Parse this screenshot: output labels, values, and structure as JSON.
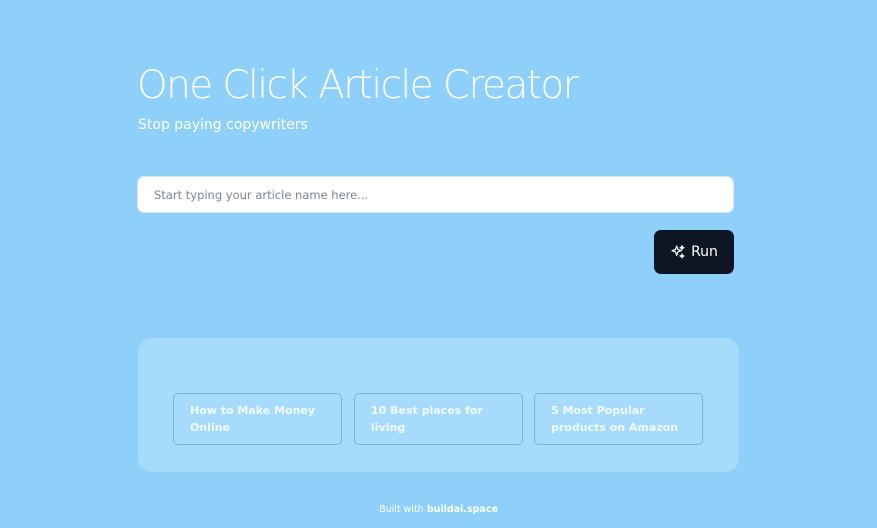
{
  "header": {
    "title": "One Click Article Creator",
    "subtitle": "Stop paying copywriters"
  },
  "search": {
    "placeholder": "Start typing your article name here...",
    "value": ""
  },
  "run_button": {
    "label": "Run",
    "icon": "sparkles-icon"
  },
  "suggestions": [
    {
      "label": "How to Make Money Online"
    },
    {
      "label": "10 Best places for living"
    },
    {
      "label": "5 Most Popular products on Amazon"
    }
  ],
  "footer": {
    "prefix": "Built with",
    "link_label": "buildai.space"
  },
  "colors": {
    "background": "#8ed0fa",
    "panel": "#a7dbfb",
    "button": "#0e1624",
    "text": "#ffffff"
  }
}
